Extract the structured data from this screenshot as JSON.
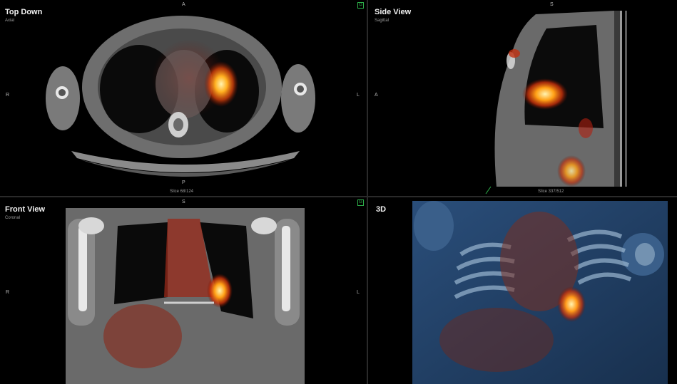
{
  "views": {
    "top_down": {
      "title": "Top Down",
      "subtitle": "Axial",
      "orient_top": "A",
      "orient_left": "R",
      "orient_right": "L",
      "orient_bottom": "P",
      "slice": "Slice 68/124",
      "sync_icon": "G"
    },
    "side_view": {
      "title": "Side View",
      "subtitle": "Sagittal",
      "orient_top": "S",
      "orient_left": "A",
      "slice": "Slice 337/512"
    },
    "front_view": {
      "title": "Front View",
      "subtitle": "Coronal",
      "orient_top": "S",
      "orient_left": "R",
      "orient_right": "L",
      "sync_icon": "G"
    },
    "three_d": {
      "title": "3D"
    }
  },
  "colors": {
    "sync": "#2db04a",
    "hotspot": "#ff9a1a",
    "background": "#000000"
  }
}
